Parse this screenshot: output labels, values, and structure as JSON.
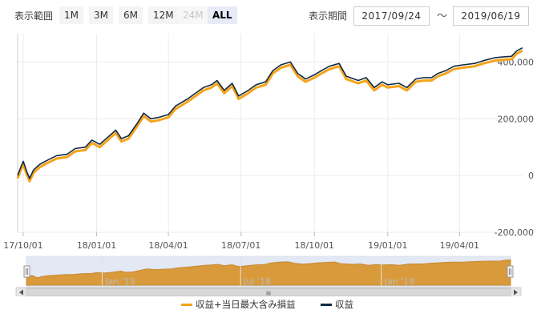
{
  "toolbar": {
    "range_label": "表示範囲",
    "ranges": [
      {
        "label": "1M",
        "state": "normal"
      },
      {
        "label": "3M",
        "state": "normal"
      },
      {
        "label": "6M",
        "state": "normal"
      },
      {
        "label": "12M",
        "state": "normal"
      },
      {
        "label": "24M",
        "state": "disabled"
      },
      {
        "label": "ALL",
        "state": "active"
      }
    ],
    "period_label": "表示期間",
    "date_from": "2017/09/24",
    "separator": "～",
    "date_to": "2019/06/19"
  },
  "navigator": {
    "ticks": [
      "Jan '18",
      "Jul '18",
      "Jan '19"
    ],
    "scrollbar_grip": "≡"
  },
  "chart_data": {
    "type": "line",
    "x_ticks": [
      "17/10/01",
      "18/01/01",
      "18/04/01",
      "18/07/01",
      "18/10/01",
      "19/01/01",
      "19/04/01"
    ],
    "y_ticks": [
      "400,000",
      "200,000",
      "0",
      "-200,000"
    ],
    "ylim": [
      -200000,
      500000
    ],
    "xlim": [
      "2017-09-24",
      "2019-06-19"
    ],
    "legend_position": "bottom",
    "grid": true,
    "series": [
      {
        "name": "収益+当日最大含み損益",
        "color": "#f5a31b",
        "offset": -10000
      },
      {
        "name": "収益",
        "color": "#102a43",
        "points": [
          [
            "2017-09-24",
            0
          ],
          [
            "2017-09-28",
            30000
          ],
          [
            "2017-10-01",
            50000
          ],
          [
            "2017-10-06",
            10000
          ],
          [
            "2017-10-09",
            -10000
          ],
          [
            "2017-10-14",
            20000
          ],
          [
            "2017-10-22",
            40000
          ],
          [
            "2017-11-01",
            55000
          ],
          [
            "2017-11-12",
            70000
          ],
          [
            "2017-11-25",
            75000
          ],
          [
            "2017-12-05",
            95000
          ],
          [
            "2017-12-18",
            100000
          ],
          [
            "2017-12-26",
            125000
          ],
          [
            "2018-01-05",
            110000
          ],
          [
            "2018-01-15",
            135000
          ],
          [
            "2018-01-25",
            160000
          ],
          [
            "2018-02-01",
            130000
          ],
          [
            "2018-02-10",
            140000
          ],
          [
            "2018-02-20",
            180000
          ],
          [
            "2018-03-01",
            220000
          ],
          [
            "2018-03-10",
            200000
          ],
          [
            "2018-03-20",
            205000
          ],
          [
            "2018-04-01",
            215000
          ],
          [
            "2018-04-10",
            245000
          ],
          [
            "2018-04-25",
            270000
          ],
          [
            "2018-05-05",
            290000
          ],
          [
            "2018-05-15",
            310000
          ],
          [
            "2018-05-25",
            320000
          ],
          [
            "2018-06-01",
            335000
          ],
          [
            "2018-06-10",
            300000
          ],
          [
            "2018-06-20",
            325000
          ],
          [
            "2018-06-28",
            280000
          ],
          [
            "2018-07-10",
            300000
          ],
          [
            "2018-07-20",
            320000
          ],
          [
            "2018-08-01",
            330000
          ],
          [
            "2018-08-10",
            370000
          ],
          [
            "2018-08-20",
            390000
          ],
          [
            "2018-09-01",
            400000
          ],
          [
            "2018-09-10",
            360000
          ],
          [
            "2018-09-20",
            340000
          ],
          [
            "2018-10-01",
            355000
          ],
          [
            "2018-10-10",
            370000
          ],
          [
            "2018-10-20",
            385000
          ],
          [
            "2018-11-01",
            395000
          ],
          [
            "2018-11-10",
            350000
          ],
          [
            "2018-11-25",
            335000
          ],
          [
            "2018-12-05",
            345000
          ],
          [
            "2018-12-15",
            310000
          ],
          [
            "2018-12-25",
            330000
          ],
          [
            "2019-01-01",
            320000
          ],
          [
            "2019-01-15",
            325000
          ],
          [
            "2019-01-25",
            310000
          ],
          [
            "2019-02-05",
            340000
          ],
          [
            "2019-02-15",
            345000
          ],
          [
            "2019-02-25",
            345000
          ],
          [
            "2019-03-05",
            360000
          ],
          [
            "2019-03-15",
            370000
          ],
          [
            "2019-03-25",
            385000
          ],
          [
            "2019-04-05",
            390000
          ],
          [
            "2019-04-20",
            395000
          ],
          [
            "2019-05-01",
            405000
          ],
          [
            "2019-05-15",
            415000
          ],
          [
            "2019-05-25",
            418000
          ],
          [
            "2019-06-05",
            420000
          ],
          [
            "2019-06-12",
            440000
          ],
          [
            "2019-06-19",
            450000
          ]
        ]
      }
    ]
  }
}
